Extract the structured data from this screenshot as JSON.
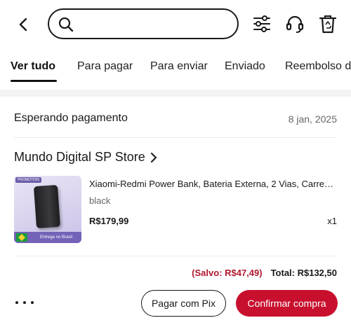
{
  "search": {
    "value": "",
    "placeholder": ""
  },
  "tabs": [
    {
      "label": "Ver tudo",
      "active": true
    },
    {
      "label": "Para pagar"
    },
    {
      "label": "Para enviar"
    },
    {
      "label": "Enviado"
    },
    {
      "label": "Reembolso de"
    }
  ],
  "order": {
    "status": "Esperando pagamento",
    "date": "8 jan, 2025",
    "store": "Mundo Digital SP Store",
    "product": {
      "title": "Xiaomi-Redmi Power Bank, Bateria Externa, 2 Vias, Carrega...",
      "variant": "black",
      "price": "R$179,99",
      "quantity": "x1",
      "image_badge": "PROMOTION",
      "image_caption": "Entrega no Brasil"
    },
    "saved": "(Salvo: R$47,49)",
    "total": "Total: R$132,50",
    "pix_button": "Pagar com Pix",
    "confirm_button": "Confirmar compra"
  },
  "colors": {
    "accent": "#c8102e",
    "saved": "#b0182f",
    "text": "#191919"
  },
  "icons": [
    "back-arrow-icon",
    "search-icon",
    "filter-sliders-icon",
    "headset-icon",
    "recycle-bin-icon",
    "chevron-right-icon",
    "more-dots-icon"
  ]
}
